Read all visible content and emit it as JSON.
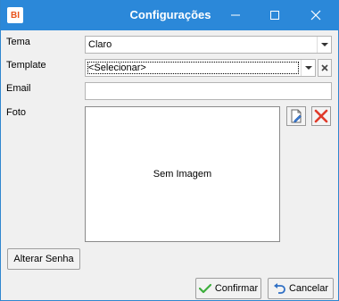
{
  "window": {
    "title": "Configurações",
    "app_icon_text": "BI",
    "accent_color": "#2b88d9"
  },
  "form": {
    "tema": {
      "label": "Tema",
      "value": "Claro"
    },
    "template": {
      "label": "Template",
      "value": "<Selecionar>"
    },
    "email": {
      "label": "Email",
      "value": ""
    },
    "foto": {
      "label": "Foto",
      "placeholder_text": "Sem Imagem"
    }
  },
  "buttons": {
    "alterar_senha": "Alterar Senha",
    "confirmar": "Confirmar",
    "cancelar": "Cancelar"
  },
  "icons": {
    "app": "bi-logo-icon",
    "minimize": "minimize-icon",
    "maximize": "maximize-icon",
    "close": "close-icon",
    "edit_photo": "edit-document-icon",
    "delete_photo": "red-x-icon",
    "confirm": "checkmark-icon",
    "cancel": "undo-arrow-icon"
  }
}
